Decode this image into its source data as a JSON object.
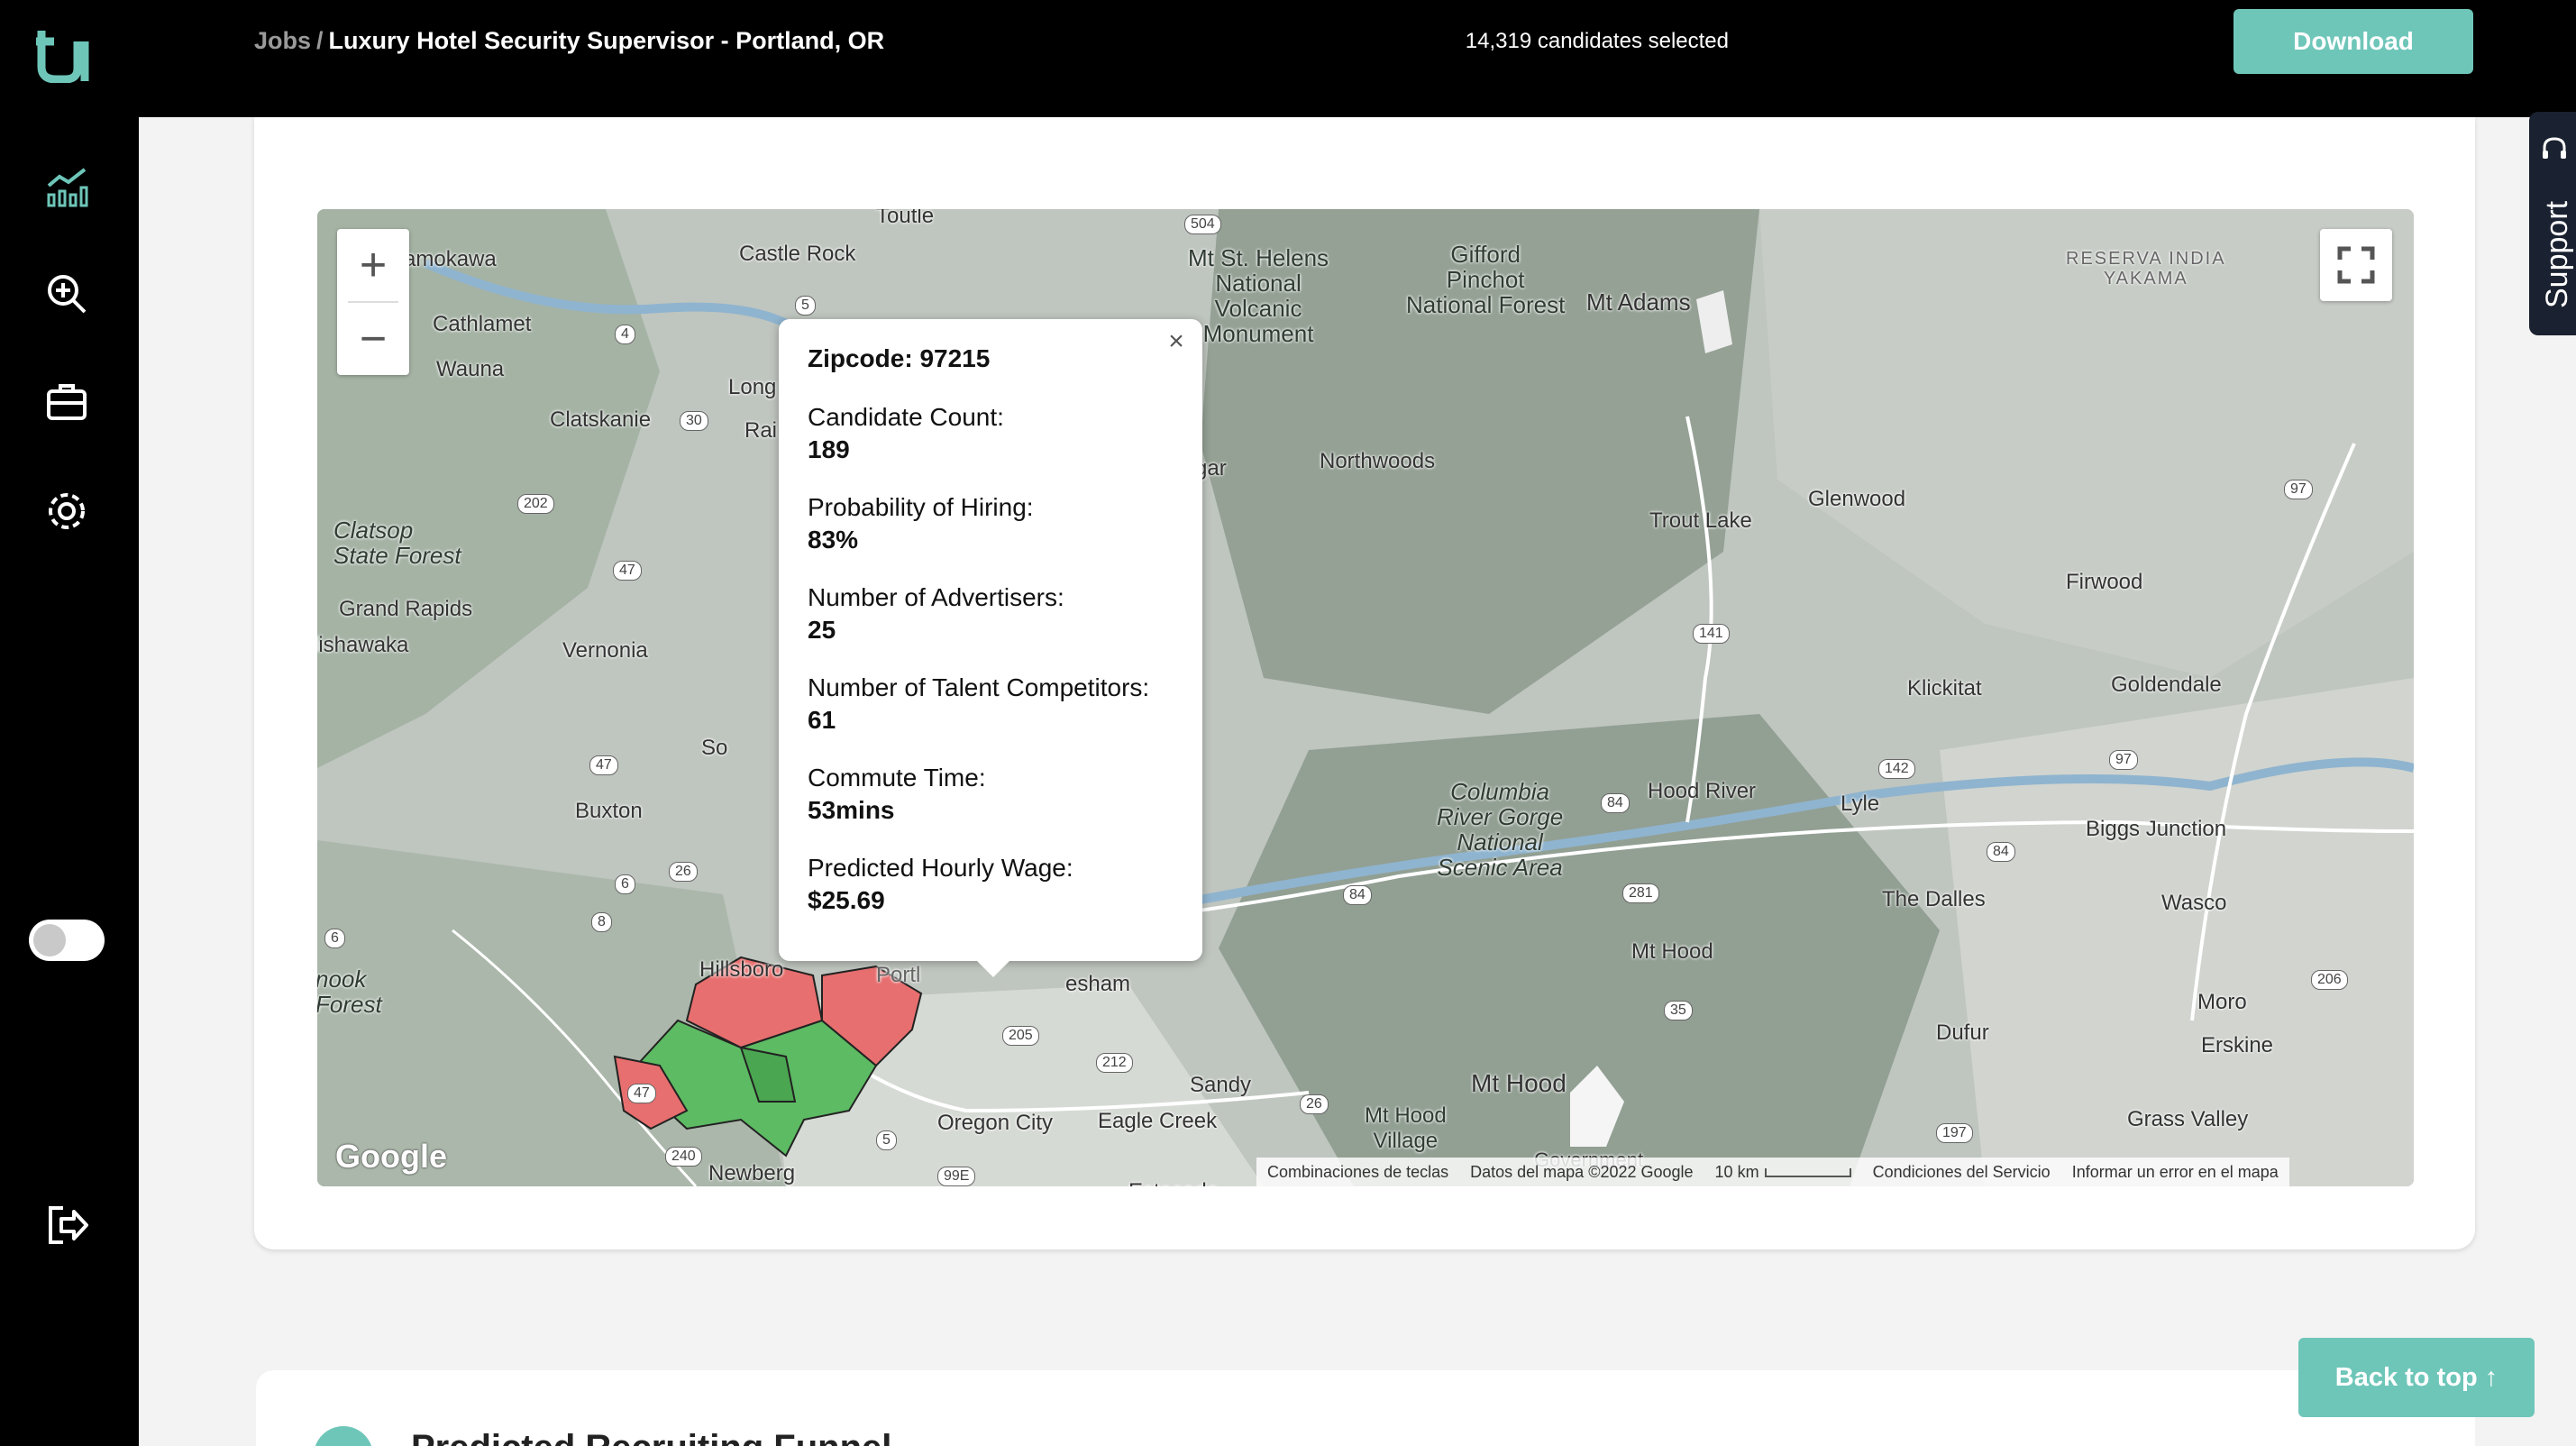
{
  "header": {
    "breadcrumb_root": "Jobs",
    "breadcrumb_sep": "/",
    "job_title": "Luxury Hotel Security Supervisor - Portland, OR",
    "selected_count": "14,319 candidates selected",
    "download_label": "Download"
  },
  "sidebar": {
    "logo_icon": "u-logo",
    "items": [
      {
        "name": "analytics",
        "icon": "chart-icon"
      },
      {
        "name": "search",
        "icon": "search-zoom-icon"
      },
      {
        "name": "jobs",
        "icon": "briefcase-icon"
      },
      {
        "name": "settings",
        "icon": "gear-icon"
      }
    ],
    "toggle_state": "off",
    "logout_icon": "logout-icon"
  },
  "map": {
    "zoom_in": "+",
    "zoom_out": "−",
    "popup": {
      "zipcode": "Zipcode: 97215",
      "fields": [
        {
          "label": "Candidate Count:",
          "value": "189"
        },
        {
          "label": "Probability of Hiring:",
          "value": "83%"
        },
        {
          "label": "Number of Advertisers:",
          "value": "25"
        },
        {
          "label": "Number of Talent Competitors:",
          "value": "61"
        },
        {
          "label": "Commute Time:",
          "value": "53mins"
        },
        {
          "label": "Predicted Hourly Wage:",
          "value": "$25.69"
        }
      ]
    },
    "places": {
      "castle_rock": "Castle Rock",
      "kamokawa": "amokawa",
      "cathlamet": "Cathlamet",
      "wauna": "Wauna",
      "clatskanie": "Clatskanie",
      "longview": "Long",
      "rainier": "Rai",
      "clatsop": "Clatsop\nState Forest",
      "grand_rapids": "Grand Rapids",
      "mishawaka": "lishawaka",
      "vernonia": "Vernonia",
      "buxton": "Buxton",
      "hillsboro": "Hillsboro",
      "tillamook": "nook\nForest",
      "newberg": "Newberg",
      "oregon_city": "Oregon City",
      "eagle_creek": "Eagle Creek",
      "sandy": "Sandy",
      "gresham": "esham",
      "mt_hood_village": "Mt Hood\nVillage",
      "government_camp": "Government",
      "mt_hood": "Mt Hood",
      "mt_hood_town": "Mt Hood",
      "mt_st_helens": "Mt St. Helens\nNational\nVolcanic\nMonument",
      "gifford_pinchot": "Gifford\nPinchot\nNational Forest",
      "mt_adams": "Mt Adams",
      "northwoods": "Northwoods",
      "cougar": "gar",
      "trout_lake": "Trout Lake",
      "glenwood": "Glenwood",
      "firwood": "Firwood",
      "klickitat": "Klickitat",
      "goldendale": "Goldendale",
      "hood_river": "Hood River",
      "lyle": "Lyle",
      "biggs_junction": "Biggs Junction",
      "the_dalles": "The Dalles",
      "wasco": "Wasco",
      "dufur": "Dufur",
      "moro": "Moro",
      "erskine": "Erskine",
      "grass_valley": "Grass Valley",
      "columbia_gorge": "Columbia\nRiver Gorge\nNational\nScenic Area",
      "yakama": "RESERVA INDIA\nYAKAMA",
      "toutle": "Toutle",
      "so": "So",
      "estacada": "Estacada",
      "portland": "Portl"
    },
    "shields": [
      "504",
      "5",
      "4",
      "30",
      "202",
      "47",
      "47",
      "26",
      "6",
      "8",
      "6",
      "47",
      "240",
      "99E",
      "5",
      "212",
      "26",
      "35",
      "281",
      "84",
      "84",
      "84",
      "141",
      "142",
      "97",
      "97",
      "197",
      "206",
      "205"
    ],
    "google_logo": "Google",
    "attribution": {
      "shortcuts": "Combinaciones de teclas",
      "data": "Datos del mapa ©2022 Google",
      "scale": "10 km",
      "terms": "Condiciones del Servicio",
      "report": "Informar un error en el mapa"
    }
  },
  "support_label": "Support",
  "back_to_top": "Back to top ↑",
  "next_section_title": "Predicted Recruiting Funnel",
  "colors": {
    "accent": "#6ec6b9",
    "header_bg": "#000000",
    "zip_green": "#5dbb63",
    "zip_red": "#e86f6f"
  }
}
